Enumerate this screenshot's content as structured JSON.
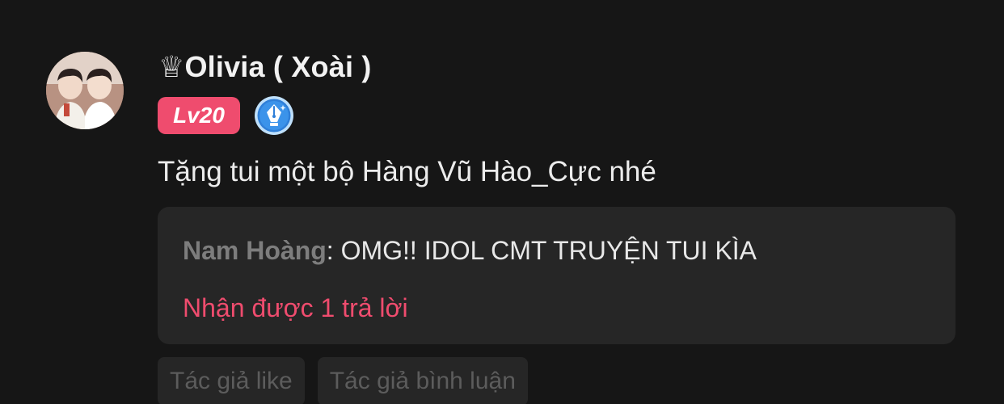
{
  "comment": {
    "user": {
      "display_name": "♕Olivia ( Xoài )",
      "level_badge": "Lv20",
      "avatar_icon": "user-avatar",
      "author_badge_icon": "pen-nib-badge-icon"
    },
    "text": "Tặng tui một bộ Hàng Vũ Hào_Cực nhé",
    "reply_preview": {
      "author": "Nam Hoàng",
      "separator": ": ",
      "text": "OMG!! IDOL CMT TRUYỆN TUI KÌA",
      "reply_count_text": "Nhận được 1 trả lời"
    },
    "tags": [
      {
        "label": "Tác giả like"
      },
      {
        "label": "Tác giả bình luận"
      }
    ]
  },
  "colors": {
    "background": "#161616",
    "card": "#262626",
    "accent": "#ef4c6e",
    "badge_blue": "#2f7fd8"
  }
}
